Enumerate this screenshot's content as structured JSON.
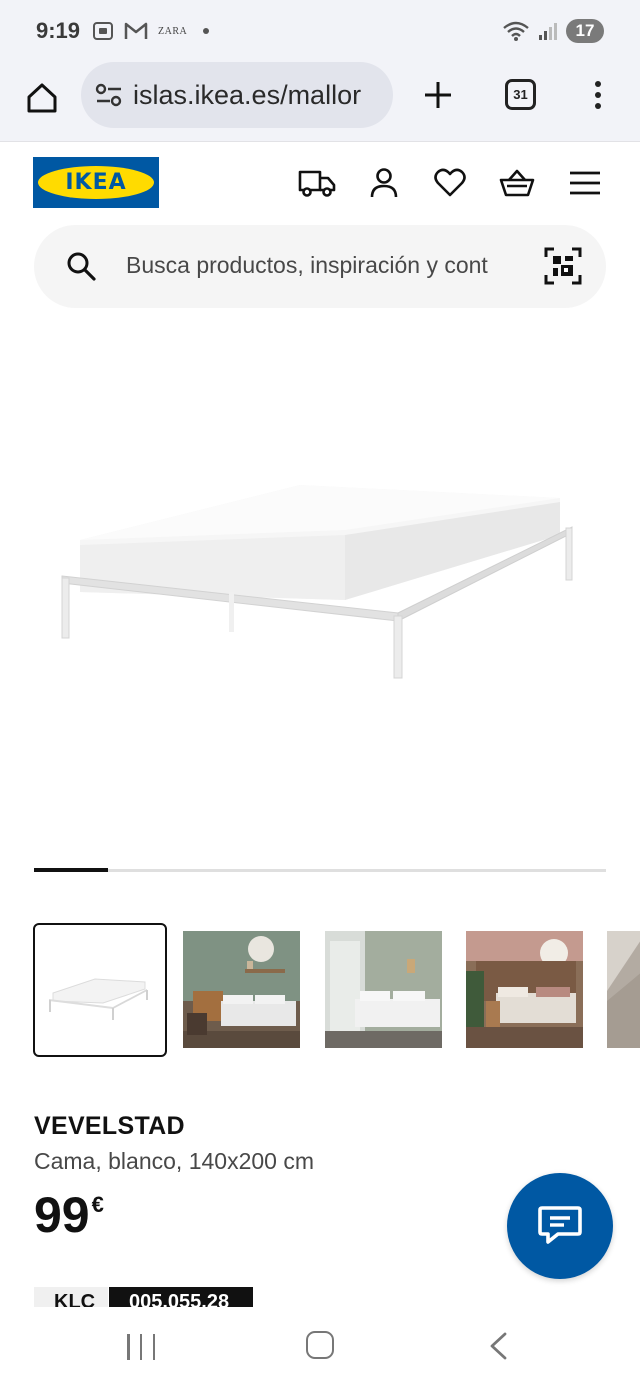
{
  "status_bar": {
    "time": "9:19",
    "notification_icons": [
      "screenshot-icon",
      "gmail-icon",
      "zara-icon"
    ],
    "zara_text": "ZARA",
    "battery": "17"
  },
  "browser": {
    "url": "islas.ikea.es/mallor",
    "tab_count": "31"
  },
  "header": {
    "logo_text": "IKEA",
    "icons": [
      "delivery-truck-icon",
      "account-icon",
      "wishlist-heart-icon",
      "basket-icon",
      "hamburger-menu-icon"
    ]
  },
  "search": {
    "placeholder": "Busca productos, inspiración y cont"
  },
  "gallery": {
    "progress": 0.13,
    "thumbnails": [
      {
        "name": "thumb-bed-frame",
        "selected": true
      },
      {
        "name": "thumb-green-bedroom",
        "selected": false
      },
      {
        "name": "thumb-white-bedroom",
        "selected": false
      },
      {
        "name": "thumb-rustic-bedroom",
        "selected": false
      },
      {
        "name": "thumb-floor",
        "selected": false
      }
    ]
  },
  "product": {
    "name": "VEVELSTAD",
    "description": "Cama, blanco, 140x200 cm",
    "price": "99",
    "currency": "€",
    "tag_label": "KLC",
    "tag_code": "005.055.28"
  },
  "colors": {
    "ikea_blue": "#0058a3",
    "ikea_yellow": "#ffdb00",
    "chrome_bg": "#f2f3f8"
  }
}
